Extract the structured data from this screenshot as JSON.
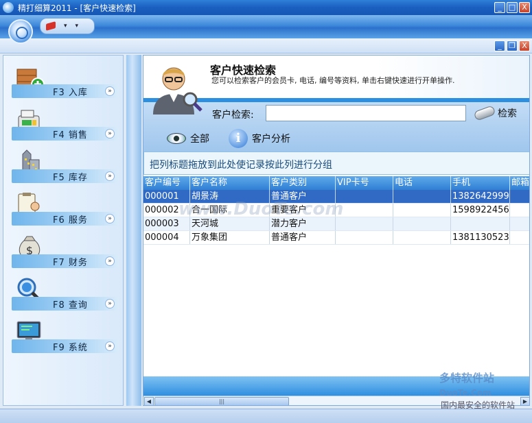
{
  "window": {
    "title": "精打细算2011 - [客户快速检索]",
    "min": "_",
    "max": "□",
    "close": "X"
  },
  "mdi": {
    "min": "_",
    "restore": "❐",
    "close": "X"
  },
  "nav": [
    {
      "label": "F3 入库",
      "icon": "box-in-icon"
    },
    {
      "label": "F4 销售",
      "icon": "cash-register-icon"
    },
    {
      "label": "F5 库存",
      "icon": "building-icon"
    },
    {
      "label": "F6 服务",
      "icon": "clipboard-person-icon"
    },
    {
      "label": "F7 财务",
      "icon": "money-bag-icon"
    },
    {
      "label": "F8 查询",
      "icon": "magnifier-globe-icon"
    },
    {
      "label": "F9 系统",
      "icon": "monitor-icon"
    }
  ],
  "nav_chevron": "»",
  "header": {
    "title": "客户快速检索",
    "description": "您可以检索客户的会员卡, 电话, 编号等资料, 单击右键快速进行开单操作."
  },
  "search": {
    "label": "客户检索:",
    "value": "",
    "button": "检索",
    "all_label": "全部",
    "analysis_label": "客户分析"
  },
  "group_hint": "把列标题拖放到此处使记录按此列进行分组",
  "grid": {
    "columns": [
      "客户编号",
      "客户名称",
      "客户类别",
      "VIP卡号",
      "电话",
      "手机",
      "邮箱"
    ],
    "rows": [
      [
        "000001",
        "胡景涛",
        "普通客户",
        "",
        "",
        "1382642999"
      ],
      [
        "000002",
        "合一国际",
        "重要客户",
        "",
        "",
        "1598922456"
      ],
      [
        "000003",
        "天河城",
        "潜力客户",
        "",
        "",
        ""
      ],
      [
        "000004",
        "万象集团",
        "普通客户",
        "",
        "",
        "1381130523"
      ]
    ]
  },
  "scroll": {
    "thumb": "|||"
  },
  "watermark": {
    "main": "www.DuoTe.com",
    "brand": "多特软件站",
    "brand_en": "DuoTe.Com",
    "slogan": "国内最安全的软件站"
  }
}
